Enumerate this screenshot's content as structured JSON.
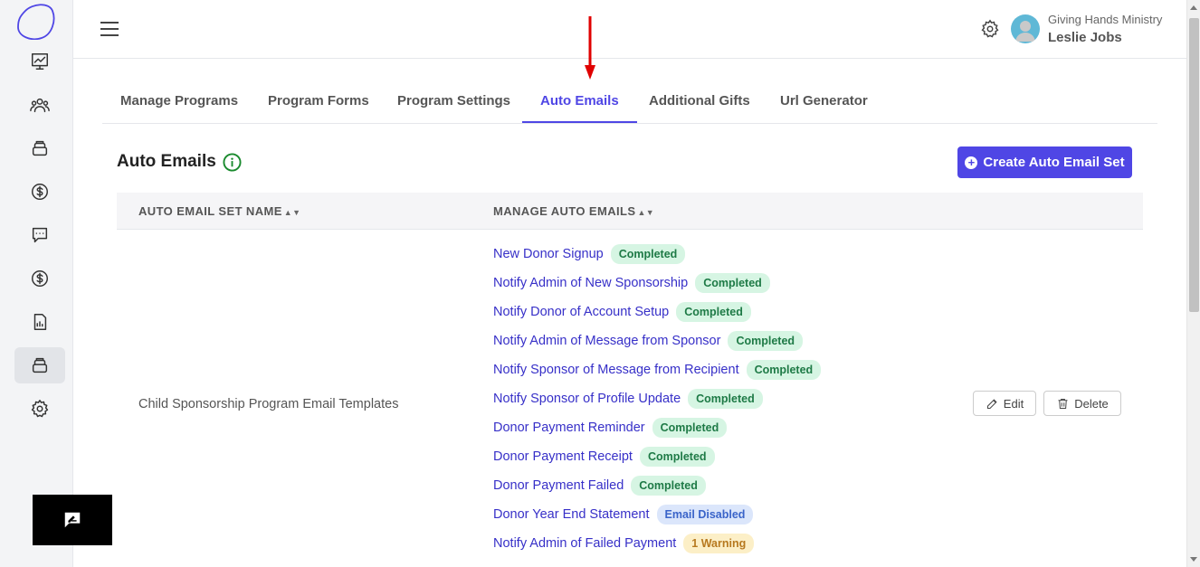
{
  "header": {
    "org_name": "Giving Hands Ministry",
    "user_name": "Leslie Jobs"
  },
  "tabs": [
    {
      "label": "Manage Programs",
      "active": false
    },
    {
      "label": "Program Forms",
      "active": false
    },
    {
      "label": "Program Settings",
      "active": false
    },
    {
      "label": "Auto Emails",
      "active": true
    },
    {
      "label": "Additional Gifts",
      "active": false
    },
    {
      "label": "Url Generator",
      "active": false
    }
  ],
  "section": {
    "title": "Auto Emails",
    "create_button": "Create Auto Email Set"
  },
  "table": {
    "columns": [
      "AUTO EMAIL SET NAME",
      "MANAGE AUTO EMAILS"
    ],
    "rows": [
      {
        "set_name": "Child Sponsorship Program Email Templates",
        "emails": [
          {
            "name": "New Donor Signup",
            "status": "Completed",
            "kind": "completed"
          },
          {
            "name": "Notify Admin of New Sponsorship",
            "status": "Completed",
            "kind": "completed"
          },
          {
            "name": "Notify Donor of Account Setup",
            "status": "Completed",
            "kind": "completed"
          },
          {
            "name": "Notify Admin of Message from Sponsor",
            "status": "Completed",
            "kind": "completed"
          },
          {
            "name": "Notify Sponsor of Message from Recipient",
            "status": "Completed",
            "kind": "completed"
          },
          {
            "name": "Notify Sponsor of Profile Update",
            "status": "Completed",
            "kind": "completed"
          },
          {
            "name": "Donor Payment Reminder",
            "status": "Completed",
            "kind": "completed"
          },
          {
            "name": "Donor Payment Receipt",
            "status": "Completed",
            "kind": "completed"
          },
          {
            "name": "Donor Payment Failed",
            "status": "Completed",
            "kind": "completed"
          },
          {
            "name": "Donor Year End Statement",
            "status": "Email Disabled",
            "kind": "disabled"
          },
          {
            "name": "Notify Admin of Failed Payment",
            "status": "1 Warning",
            "kind": "warning"
          }
        ],
        "edit_label": "Edit",
        "delete_label": "Delete"
      }
    ]
  },
  "colors": {
    "accent": "#4f46e5",
    "link": "#3730c8",
    "arrow": "#e00000"
  }
}
